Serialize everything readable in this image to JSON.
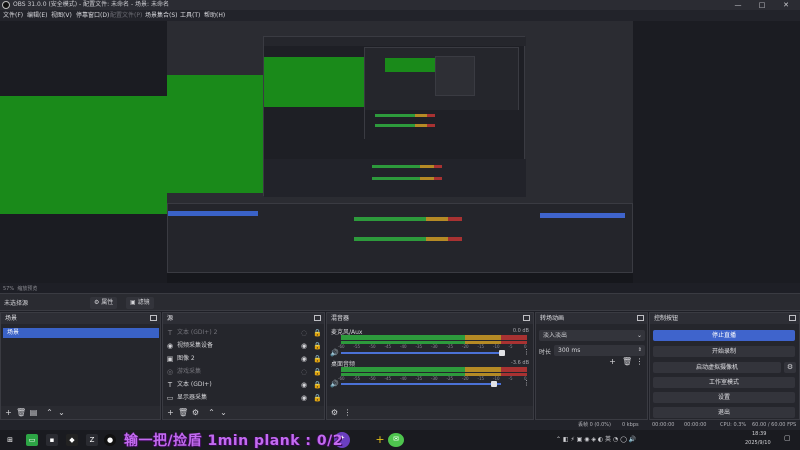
{
  "window": {
    "title": "OBS 31.0.0 (安全模式) - 配置文件: 未命名 - 场景: 未命名",
    "minimize": "—",
    "maximize": "□",
    "close": "✕"
  },
  "menu": {
    "items": [
      {
        "label": "文件(F)",
        "disabled": false
      },
      {
        "label": "编辑(E)",
        "disabled": false
      },
      {
        "label": "视图(V)",
        "disabled": false
      },
      {
        "label": "停靠窗口(D)",
        "disabled": false
      },
      {
        "label": "配置文件(P)",
        "disabled": true
      },
      {
        "label": "场景集合(S)",
        "disabled": false
      },
      {
        "label": "工具(T)",
        "disabled": false
      },
      {
        "label": "帮助(H)",
        "disabled": false
      }
    ]
  },
  "preview": {
    "zoom_status": "57%",
    "zoom_label": "缩放预览",
    "nested_overlay": "输一把/捡盾 1min plank : 0/2"
  },
  "scene_bar": {
    "current": "未选择源",
    "properties_label": "属性",
    "filters_label": "滤镜"
  },
  "scenes": {
    "header": "场景",
    "items": [
      "场景"
    ]
  },
  "sources": {
    "header": "源",
    "items": [
      {
        "label": "文本 (GDI+) 2",
        "icon": "text-icon",
        "glyph": "T",
        "dim": true
      },
      {
        "label": "视频采集设备",
        "icon": "camera-icon",
        "glyph": "◉",
        "dim": false
      },
      {
        "label": "图像 2",
        "icon": "image-icon",
        "glyph": "▣",
        "dim": false
      },
      {
        "label": "游戏采集",
        "icon": "gamepad-icon",
        "glyph": "◎",
        "dim": true
      },
      {
        "label": "文本 (GDI+)",
        "icon": "text-icon",
        "glyph": "T",
        "dim": false
      },
      {
        "label": "显示器采集",
        "icon": "monitor-icon",
        "glyph": "▭",
        "dim": false
      }
    ]
  },
  "mixer": {
    "header": "混音器",
    "channels": [
      {
        "name": "麦克风/Aux",
        "db": "0.0 dB"
      },
      {
        "name": "桌面音频",
        "db": "-3.6 dB"
      }
    ],
    "ticks": [
      "-60",
      "-55",
      "-50",
      "-45",
      "-40",
      "-35",
      "-30",
      "-25",
      "-20",
      "-15",
      "-10",
      "-5",
      "0"
    ]
  },
  "transitions": {
    "header": "转场动画",
    "selected": "淡入淡出",
    "duration_label": "时长",
    "duration_value": "300 ms"
  },
  "controls": {
    "header": "控制按钮",
    "stop_stream": "停止直播",
    "start_record": "开始录制",
    "virtual_cam": "启动虚拟摄像机",
    "studio_mode": "工作室模式",
    "settings": "设置",
    "exit": "退出"
  },
  "status": {
    "frames": "丢帧 0 (0.0%)",
    "bitrate": "0 kbps",
    "stream_time": "00:00:00",
    "record_time": "00:00:00",
    "cpu": "CPU: 0.3%",
    "fps": "60.00 / 60.00 FPS"
  },
  "taskbar": {
    "overlay_text": "输一把/捡盾 1min plank : 0/2",
    "time": "18:39",
    "date": "2025/9/10"
  },
  "colors": {
    "accent": "#3f64cc",
    "green_capture": "#1a8a1a",
    "overlay_purple": "#c36af0"
  }
}
